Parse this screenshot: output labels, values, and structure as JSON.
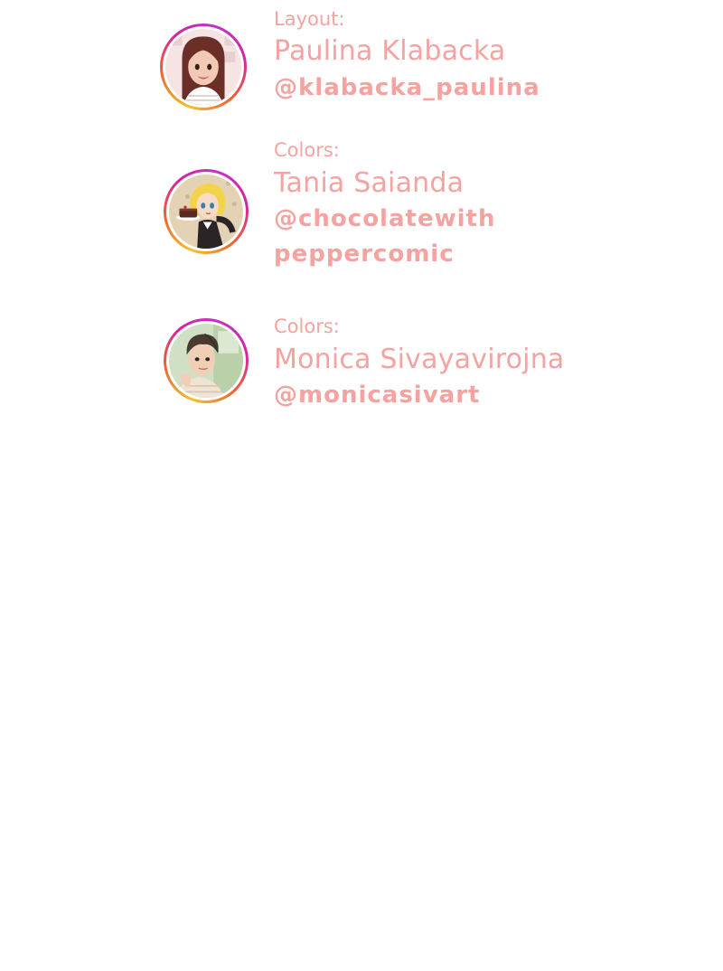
{
  "credits": [
    {
      "role": "Layout:",
      "name": "Paulina Klabacka",
      "handle_lines": [
        "@klabacka_paulina"
      ],
      "avatar_icon": "avatar-woman-long-dark-hair-icon"
    },
    {
      "role": "Colors:",
      "name": "Tania Saianda",
      "handle_lines": [
        "@chocolatewith",
        "peppercomic"
      ],
      "avatar_icon": "avatar-blonde-girl-with-cake-icon"
    },
    {
      "role": "Colors:",
      "name": "Monica Sivayavirojna",
      "handle_lines": [
        "@monicasivart"
      ],
      "avatar_icon": "avatar-man-short-hair-icon"
    }
  ],
  "colors": {
    "text": "#f4a3a1",
    "ring_gradient": [
      "#f5c12e",
      "#f0652e",
      "#d6249f",
      "#c233c9"
    ],
    "background": "#ffffff"
  }
}
